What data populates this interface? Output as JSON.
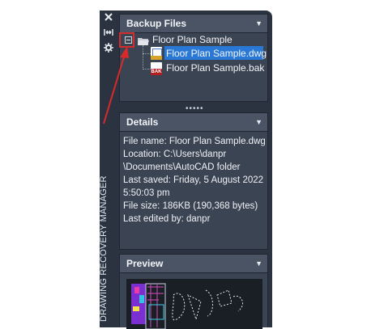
{
  "palette": {
    "vertical_title": "DRAWING RECOVERY MANAGER",
    "side_icons": [
      "close-icon",
      "auto-hide-icon",
      "settings-icon"
    ]
  },
  "backup_panel": {
    "title": "Backup Files",
    "root_label": "Floor Plan Sample",
    "files": [
      {
        "label": "Floor Plan Sample.dwg",
        "selected": true,
        "icon": "dwg-file-icon"
      },
      {
        "label": "Floor Plan Sample.bak",
        "selected": false,
        "icon": "bak-file-icon"
      }
    ],
    "resize_handle": "•••••"
  },
  "details_panel": {
    "title": "Details",
    "lines": [
      "File name: Floor Plan Sample.dwg",
      "Location: C:\\Users\\danpr",
      "\\Documents\\AutoCAD folder",
      "Last saved: Friday, 5 August 2022",
      "5:50:03 pm",
      "File size: 186KB (190,368 bytes)",
      "Last edited by: danpr"
    ]
  },
  "preview_panel": {
    "title": "Preview"
  },
  "bak_badge": "BAK",
  "colors": {
    "selection": "#2a78d6",
    "annotation": "#d62b2b",
    "panel_bg": "#3b4453",
    "header_bg": "#4a5465"
  }
}
